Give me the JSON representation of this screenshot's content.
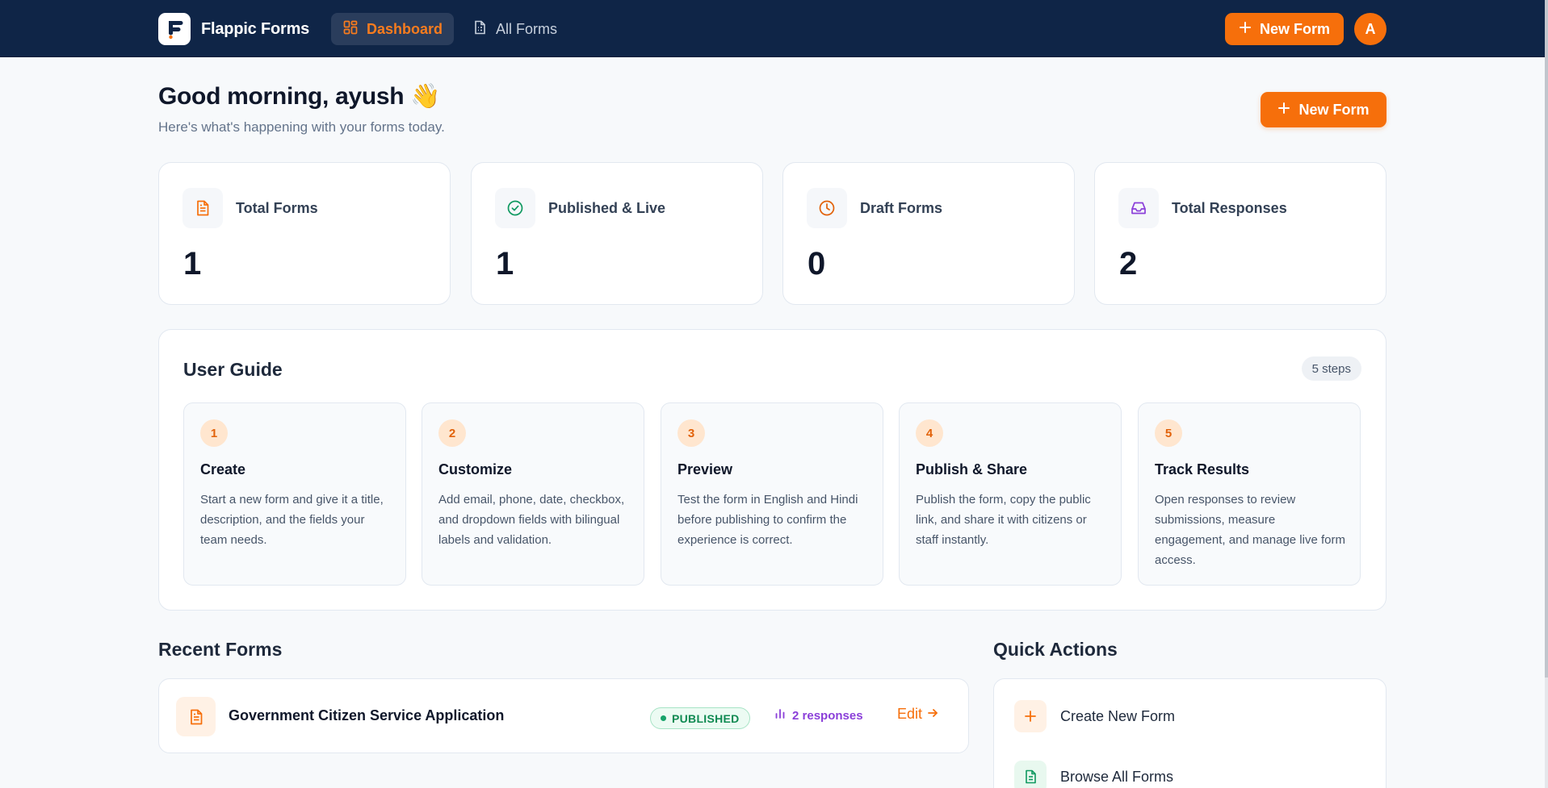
{
  "nav": {
    "brand": "Flappic Forms",
    "tabs": [
      {
        "label": "Dashboard",
        "active": true,
        "icon": "layout-grid-icon"
      },
      {
        "label": "All Forms",
        "active": false,
        "icon": "file-list-icon"
      }
    ],
    "new_form_label": "New Form",
    "avatar_initial": "A"
  },
  "header": {
    "greeting": "Good morning, ayush 👋",
    "subtitle": "Here's what's happening with your forms today.",
    "new_form_label": "New Form"
  },
  "stats": [
    {
      "label": "Total Forms",
      "value": "1",
      "icon": "file-text-icon",
      "color": "#f66f0b"
    },
    {
      "label": "Published & Live",
      "value": "1",
      "icon": "check-circle-icon",
      "color": "#0f9960"
    },
    {
      "label": "Draft Forms",
      "value": "0",
      "icon": "clock-icon",
      "color": "#e2620a"
    },
    {
      "label": "Total Responses",
      "value": "2",
      "icon": "inbox-icon",
      "color": "#8b3fd9"
    }
  ],
  "guide": {
    "title": "User Guide",
    "badge": "5 steps",
    "steps": [
      {
        "num": "1",
        "title": "Create",
        "desc": "Start a new form and give it a title, description, and the fields your team needs."
      },
      {
        "num": "2",
        "title": "Customize",
        "desc": "Add email, phone, date, checkbox, and dropdown fields with bilingual labels and validation."
      },
      {
        "num": "3",
        "title": "Preview",
        "desc": "Test the form in English and Hindi before publishing to confirm the experience is correct."
      },
      {
        "num": "4",
        "title": "Publish & Share",
        "desc": "Publish the form, copy the public link, and share it with citizens or staff instantly."
      },
      {
        "num": "5",
        "title": "Track Results",
        "desc": "Open responses to review submissions, measure engagement, and manage live form access."
      }
    ]
  },
  "recent": {
    "title": "Recent Forms",
    "forms": [
      {
        "title": "Government Citizen Service Application",
        "status": "PUBLISHED",
        "responses": "2 responses",
        "edit_label": "Edit"
      }
    ]
  },
  "quick_actions": {
    "title": "Quick Actions",
    "items": [
      {
        "label": "Create New Form",
        "icon": "plus-icon"
      },
      {
        "label": "Browse All Forms",
        "icon": "file-list-icon"
      }
    ]
  },
  "colors": {
    "nav_bg": "#0f2547",
    "accent": "#f66f0b",
    "success": "#0f9960",
    "purple": "#8b3fd9"
  }
}
